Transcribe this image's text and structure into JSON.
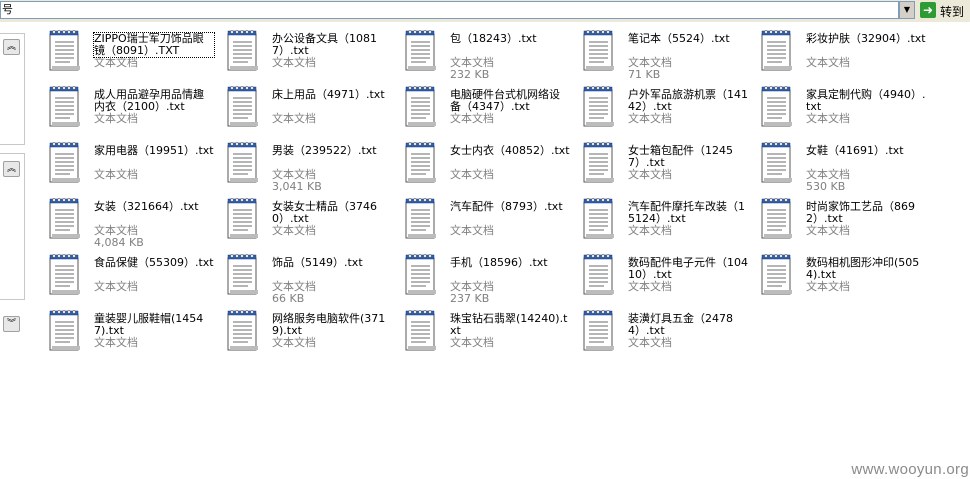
{
  "addressbar": {
    "value": "",
    "go_label": "转到",
    "label_fragment": "号"
  },
  "taskpane": {
    "buttons": [
      "collapse-up",
      "collapse-up",
      "expand-down"
    ]
  },
  "files": [
    {
      "name": "ZIPPO瑞士军刀饰品眼镜（8091）.TXT",
      "type": "文本文档",
      "size": "",
      "selected": true
    },
    {
      "name": "办公设备文具（10817）.txt",
      "type": "文本文档",
      "size": ""
    },
    {
      "name": "包（18243）.txt",
      "type": "文本文档",
      "size": "232 KB"
    },
    {
      "name": "笔记本（5524）.txt",
      "type": "文本文档",
      "size": "71 KB"
    },
    {
      "name": "彩妆护肤（32904）.txt",
      "type": "文本文档",
      "size": ""
    },
    {
      "name": "成人用品避孕用品情趣内衣（2100）.txt",
      "type": "文本文档",
      "size": ""
    },
    {
      "name": "床上用品（4971）.txt",
      "type": "文本文档",
      "size": ""
    },
    {
      "name": "电脑硬件台式机网络设备（4347）.txt",
      "type": "文本文档",
      "size": ""
    },
    {
      "name": "户外军品旅游机票（14142）.txt",
      "type": "文本文档",
      "size": ""
    },
    {
      "name": "家具定制代购（4940）.txt",
      "type": "文本文档",
      "size": ""
    },
    {
      "name": "家用电器（19951）.txt",
      "type": "文本文档",
      "size": ""
    },
    {
      "name": "男装（239522）.txt",
      "type": "文本文档",
      "size": "3,041 KB"
    },
    {
      "name": "女士内衣（40852）.txt",
      "type": "文本文档",
      "size": ""
    },
    {
      "name": "女士箱包配件（12457）.txt",
      "type": "文本文档",
      "size": ""
    },
    {
      "name": "女鞋（41691）.txt",
      "type": "文本文档",
      "size": "530 KB"
    },
    {
      "name": "女装（321664）.txt",
      "type": "文本文档",
      "size": "4,084 KB"
    },
    {
      "name": "女装女士精品（37460）.txt",
      "type": "文本文档",
      "size": ""
    },
    {
      "name": "汽车配件（8793）.txt",
      "type": "文本文档",
      "size": ""
    },
    {
      "name": "汽车配件摩托车改装（15124）.txt",
      "type": "文本文档",
      "size": ""
    },
    {
      "name": "时尚家饰工艺品（8692）.txt",
      "type": "文本文档",
      "size": ""
    },
    {
      "name": "食品保健（55309）.txt",
      "type": "文本文档",
      "size": ""
    },
    {
      "name": "饰品（5149）.txt",
      "type": "文本文档",
      "size": "66 KB"
    },
    {
      "name": "手机（18596）.txt",
      "type": "文本文档",
      "size": "237 KB"
    },
    {
      "name": "数码配件电子元件（10410）.txt",
      "type": "文本文档",
      "size": ""
    },
    {
      "name": "数码相机图形冲印(5054).txt",
      "type": "文本文档",
      "size": ""
    },
    {
      "name": "童装婴儿服鞋帽(14547).txt",
      "type": "文本文档",
      "size": ""
    },
    {
      "name": "网络服务电脑软件(3719).txt",
      "type": "文本文档",
      "size": ""
    },
    {
      "name": "珠宝钻石翡翠(14240).txt",
      "type": "文本文档",
      "size": ""
    },
    {
      "name": "装潢灯具五金（24784）.txt",
      "type": "文本文档",
      "size": ""
    }
  ],
  "watermark": "www.wooyun.org"
}
